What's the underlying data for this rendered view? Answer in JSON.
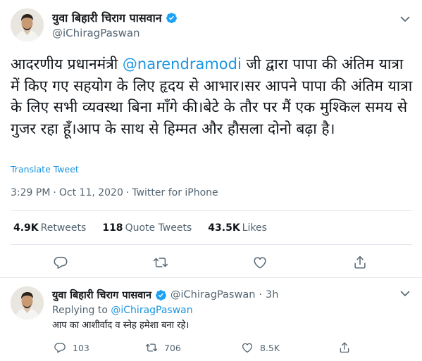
{
  "main_tweet": {
    "author_name": "युवा बिहारी चिराग पासवान",
    "author_handle": "@iChiragPaswan",
    "text_before_mention": "आदरणीय प्रधानमंत्री ",
    "mention": "@narendramodi",
    "text_after_mention": " जी द्वारा पापा की अंतिम यात्रा में किए गए सहयोग के लिए हृदय से आभार।सर आपने पापा की अंतिम यात्रा के लिए सभी व्यवस्था बिना माँगे की।बेटे के तौर पर मैं एक मुश्किल समय से गुजर रहा हूँ।आप के साथ से हिम्मत और हौसला दोनो बढ़ा है।",
    "translate_label": "Translate Tweet",
    "time": "3:29 PM",
    "separator": "·",
    "date": "Oct 11, 2020",
    "source": "Twitter for iPhone",
    "retweets_count": "4.9K",
    "retweets_label": "Retweets",
    "quotes_count": "118",
    "quotes_label": "Quote Tweets",
    "likes_count": "43.5K",
    "likes_label": "Likes"
  },
  "reply_tweet": {
    "author_name": "युवा बिहारी चिराग पासवान",
    "author_handle": "@iChiragPaswan",
    "separator": "·",
    "age": "3h",
    "replying_to_label": "Replying to",
    "replying_to_handle": "@iChiragPaswan",
    "text": "आप का आशीर्वाद व स्नेह हमेशा बना रहे।",
    "reply_count": "103",
    "retweet_count": "706",
    "like_count": "8.5K"
  },
  "colors": {
    "link": "#1b95e0",
    "secondary_text": "#536471",
    "verified": "#1da1f2",
    "divider": "#e1e8ed"
  },
  "icons": [
    "verified-badge-icon",
    "chevron-down-icon",
    "reply-icon",
    "retweet-icon",
    "like-icon",
    "share-icon"
  ]
}
